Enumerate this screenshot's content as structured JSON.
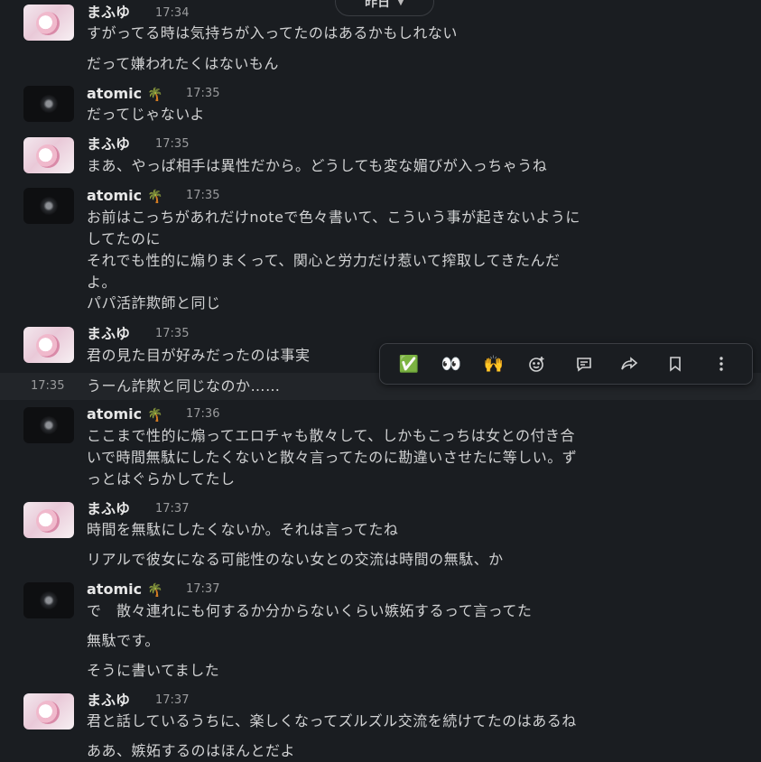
{
  "date_divider": {
    "label": "昨日"
  },
  "users": {
    "mafuyu": {
      "name": "まふゆ"
    },
    "atomic": {
      "name": "atomic",
      "badge": "🌴"
    }
  },
  "messages": [
    {
      "author": "まふゆ",
      "time": "17:34",
      "lines": [
        "すがってる時は気持ちが入ってたのはあるかもしれない",
        "だって嫌われたくはないもん"
      ]
    },
    {
      "author": "atomic",
      "time": "17:35",
      "lines": [
        "だってじゃないよ"
      ]
    },
    {
      "author": "まふゆ",
      "time": "17:35",
      "lines": [
        "まあ、やっぱ相手は異性だから。どうしても変な媚びが入っちゃうね"
      ]
    },
    {
      "author": "atomic",
      "time": "17:35",
      "lines": [
        "お前はこっちがあれだけnoteで色々書いて、こういう事が起きないように",
        "してたのに",
        "それでも性的に煽りまくって、関心と労力だけ惹いて搾取してきたんだ",
        "よ。",
        "パパ活詐欺師と同じ"
      ]
    },
    {
      "author": "まふゆ",
      "time": "17:35",
      "lines": [
        "君の見た目が好みだったのは事実"
      ]
    },
    {
      "author": "atomic",
      "time": "17:36",
      "lines": [
        "ここまで性的に煽ってエロチャも散々して、しかもこっちは女との付き合",
        "いで時間無駄にしたくないと散々言ってたのに勘違いさせたに等しい。ず",
        "っとはぐらかしてたし"
      ]
    },
    {
      "author": "まふゆ",
      "time": "17:37",
      "lines": [
        "時間を無駄にしたくないか。それは言ってたね",
        "リアルで彼女になる可能性のない女との交流は時間の無駄、か"
      ]
    },
    {
      "author": "atomic",
      "time": "17:37",
      "lines": [
        "で　散々連れにも何するか分からないくらい嫉妬するって言ってた",
        "無駄です。",
        "そうに書いてました"
      ]
    },
    {
      "author": "まふゆ",
      "time": "17:37",
      "lines": [
        "君と話しているうちに、楽しくなってズルズル交流を続けてたのはあるね",
        "ああ、嫉妬するのはほんとだよ"
      ]
    }
  ],
  "hovered_message": {
    "time": "17:35",
    "text": "うーん詐欺と同じなのか……"
  },
  "toolbar": {
    "buttons": [
      {
        "icon": "check-mark-reaction-icon",
        "glyph": "✅"
      },
      {
        "icon": "eyes-reaction-icon",
        "glyph": "👀"
      },
      {
        "icon": "raised-hands-reaction-icon",
        "glyph": "🙌"
      },
      {
        "icon": "add-reaction-icon"
      },
      {
        "icon": "reply-in-thread-icon"
      },
      {
        "icon": "share-message-icon"
      },
      {
        "icon": "save-bookmark-icon"
      },
      {
        "icon": "more-actions-icon"
      }
    ]
  },
  "colors": {
    "background": "#1a1d21",
    "hover_row": "#222529",
    "text": "#d1d2d3",
    "muted": "#9a9b9d"
  }
}
